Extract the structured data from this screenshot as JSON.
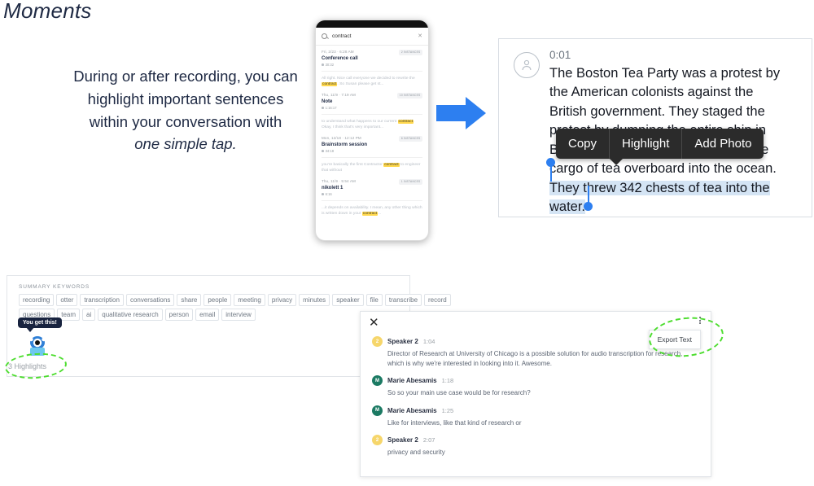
{
  "slide": {
    "title": "ant Moments",
    "body_line1": "During or after recording, you can",
    "body_line2": "highlight important sentences",
    "body_line3": "within your conversation with",
    "body_emphasis": "one simple tap."
  },
  "phone": {
    "search": {
      "icon": "search-icon",
      "query": "contract",
      "clear_icon": "close-icon"
    },
    "results": [
      {
        "date": "Fri, 2/23 · 6:28 AM",
        "badge": "2 INSTANCES",
        "title": "Conference call",
        "duration": "30:32",
        "snippet_pre": "All right. Nice call everyone we decided to rewrite the ",
        "snippet_hl": "contract",
        "snippet_post": ". So Susan please get st..."
      },
      {
        "date": "Thu, 11/9 · 7:19 AM",
        "badge": "10 INSTANCES",
        "title": "Note",
        "duration": "1:16:17",
        "snippet_pre": "to understand what happens to our current ",
        "snippet_hl": "contract",
        "snippet_post": ". Okay, I think that's very important..."
      },
      {
        "date": "Mon, 12/18 · 12:12 PM",
        "badge": "6 INSTANCES",
        "title": "Brainstorm session",
        "duration": "34:18",
        "snippet_pre": "you're basically the first Contractor ",
        "snippet_hl": "contract",
        "snippet_post": " to engineer that without"
      },
      {
        "date": "Thu, 11/9 · 5:54 AM",
        "badge": "1 INSTANCES",
        "title": "nikolett 1",
        "duration": "6:16",
        "snippet_pre": "...it depends on availability. I mean, any other thing which is written down in your ",
        "snippet_hl": "contract",
        "snippet_post": "..."
      }
    ]
  },
  "arrow": {
    "icon": "arrow-right-icon",
    "color": "#2d7ff0"
  },
  "transcript_card": {
    "avatar_icon": "person-icon",
    "timestamp": "0:01",
    "text_line1": "The Boston Tea Party was a protest by",
    "text_line2": "the American colonists against the",
    "text_line3": "British government. They staged the",
    "text_line4": "protest by dumping the entire ship in",
    "text_line5": "Boston Harbor. They threw the entire",
    "text_line6": "cargo of tea overboard into the ocean.",
    "selected_line1": "They threw 342 chests of tea into the",
    "selected_line2": "water.",
    "selection_color": "#d4e4f4",
    "handle_color": "#2d7ff0"
  },
  "context_menu": {
    "items": [
      {
        "label": "Copy",
        "name": "copy-menu-item"
      },
      {
        "label": "Highlight",
        "name": "highlight-menu-item"
      },
      {
        "label": "Add Photo",
        "name": "add-photo-menu-item"
      }
    ]
  },
  "keywords_panel": {
    "section_label": "SUMMARY KEYWORDS",
    "row1": [
      "recording",
      "otter",
      "transcription",
      "conversations",
      "share",
      "people",
      "meeting",
      "privacy",
      "minutes",
      "speaker",
      "file",
      "transcribe",
      "record"
    ],
    "row2": [
      "questions",
      "team",
      "ai",
      "qualitative research",
      "person",
      "email",
      "interview"
    ],
    "mascot": {
      "tooltip": "You get this!",
      "icon": "otter-mascot-icon",
      "highlights_count": "3 Highlights",
      "annotation_color": "#4ddd2f"
    }
  },
  "bottom_panel": {
    "close_icon": "close-icon",
    "overflow_icon": "more-vertical-icon",
    "export_menu_label": "Export Text",
    "annotation_color": "#4ddd2f",
    "segments": [
      {
        "initial": "2",
        "avatar_color": "#f6d66b",
        "speaker": "Speaker 2",
        "time": "1:04",
        "text": "Director of Research at University of Chicago is a possible solution for audio transcription for research, which is why we're interested in looking into it. Awesome."
      },
      {
        "initial": "M",
        "avatar_color": "#1c7a63",
        "speaker": "Marie Abesamis",
        "time": "1:18",
        "text": "So so your main use case would be for research?"
      },
      {
        "initial": "M",
        "avatar_color": "#1c7a63",
        "speaker": "Marie Abesamis",
        "time": "1:25",
        "text": "Like for interviews, like that kind of research or"
      },
      {
        "initial": "2",
        "avatar_color": "#f6d66b",
        "speaker": "Speaker 2",
        "time": "2:07",
        "text": "privacy and security"
      }
    ]
  }
}
